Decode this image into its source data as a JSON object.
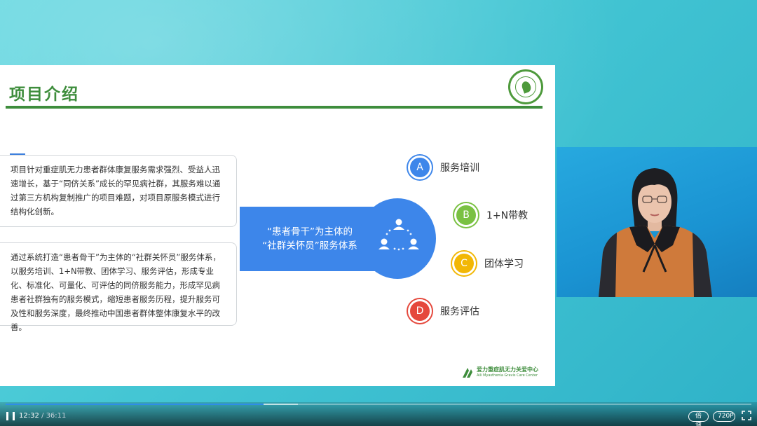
{
  "slide": {
    "title": "项目介绍",
    "paragraph1": "项目针对重症肌无力患者群体康复服务需求强烈、受益人迅速增长，基于“同侪关系”成长的罕见病社群，其服务难以通过第三方机构复制推广的项目难题，对项目原服务模式进行结构化创新。",
    "paragraph2": "通过系统打造“患者骨干”为主体的“社群关怀员”服务体系，以服务培训、1+N带教、团体学习、服务评估，形成专业化、标准化、可量化、可评估的同侪服务能力，形成罕见病患者社群独有的服务模式，缩短患者服务历程，提升服务可及性和服务深度，最终推动中国患者群体整体康复水平的改善。",
    "banner_line1": "“患者骨干”为主体的",
    "banner_line2": "“社群关怀员”服务体系",
    "options": [
      {
        "letter": "A",
        "label": "服务培训",
        "color": "#3d86ea"
      },
      {
        "letter": "B",
        "label": "1+N带教",
        "color": "#7ac142"
      },
      {
        "letter": "C",
        "label": "团体学习",
        "color": "#f2b705"
      },
      {
        "letter": "D",
        "label": "服务评估",
        "color": "#e5483c"
      }
    ],
    "footer_cn": "爱力重症肌无力关爱中心",
    "footer_en": "Aili Myasthenia Gravis Care Center"
  },
  "player": {
    "current_time": "12:32",
    "separator": " / ",
    "total_time": "36:11",
    "progress": 0.346,
    "buffered": 0.392,
    "speed_label": "倍速",
    "quality_label": "720P"
  },
  "icons": {
    "pause": "pause-icon",
    "fullscreen": "fullscreen-icon",
    "people": "people-group-icon",
    "seal": "organization-seal-logo"
  }
}
